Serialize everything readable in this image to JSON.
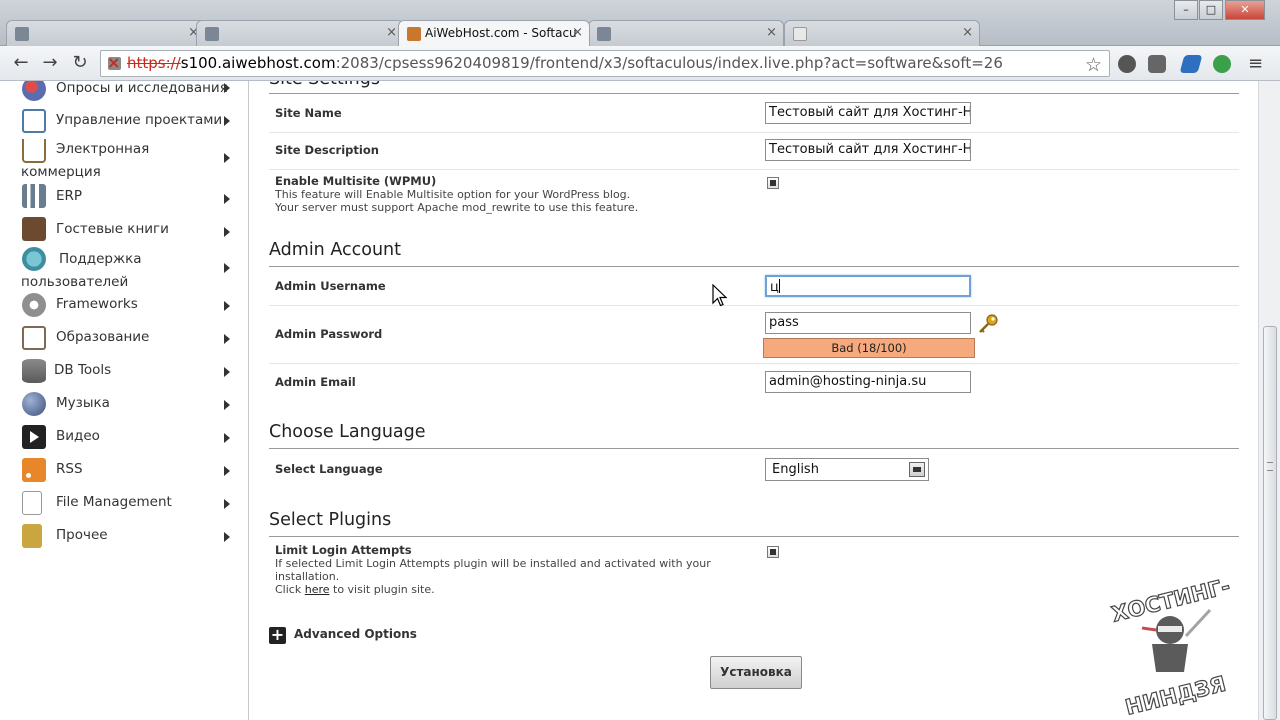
{
  "browser": {
    "tabs": [
      {
        "label": "",
        "active": false
      },
      {
        "label": "",
        "active": false
      },
      {
        "label": "AiWebHost.com - Softacu",
        "active": true
      },
      {
        "label": "",
        "active": false
      },
      {
        "label": "",
        "active": false
      }
    ],
    "url": {
      "protocol": "https://",
      "host": "s100.aiwebhost.com",
      "path": ":2083/cpsess9620409819/frontend/x3/softaculous/index.live.php?act=software&soft=26"
    },
    "win_minimize": "–",
    "win_maximize": "□",
    "win_close": "✕"
  },
  "sidebar": {
    "items": [
      {
        "label": "Опросы и исследования",
        "icon": "polls-icon",
        "color": "#5b6db0"
      },
      {
        "label": "Управление проектами",
        "icon": "project-management-icon",
        "color": "#4f7aa6"
      },
      {
        "label": "Электронная",
        "label_line2": "коммерция",
        "icon": "cart-icon",
        "color": "#8a6d3b"
      },
      {
        "label": "ERP",
        "icon": "erp-icon",
        "color": "#6a7d8f"
      },
      {
        "label": "Гостевые книги",
        "icon": "guestbook-icon",
        "color": "#6b4a2f"
      },
      {
        "label": "Поддержка",
        "label_line2": "пользователей",
        "icon": "support-icon",
        "color": "#3d8e9e"
      },
      {
        "label": "Frameworks",
        "icon": "frameworks-icon",
        "color": "#8f8f8f"
      },
      {
        "label": "Образование",
        "icon": "education-icon",
        "color": "#7c6a55"
      },
      {
        "label": "DB Tools",
        "icon": "db-tools-icon",
        "color": "#6e6e6e"
      },
      {
        "label": "Музыка",
        "icon": "music-icon",
        "color": "#3b4f7a"
      },
      {
        "label": "Видео",
        "icon": "video-icon",
        "color": "#222222"
      },
      {
        "label": "RSS",
        "icon": "rss-icon",
        "color": "#e8862a"
      },
      {
        "label": "File Management",
        "icon": "file-icon",
        "color": "#d8d8d8"
      },
      {
        "label": "Прочее",
        "icon": "misc-icon",
        "color": "#c9a640"
      }
    ]
  },
  "form": {
    "site_settings_title": "Site Settings",
    "site_name_label": "Site Name",
    "site_name_value": "Тестовый сайт для Хостинг-Ниндзя",
    "site_desc_label": "Site Description",
    "site_desc_value": "Тестовый сайт для Хостинг-Ниндзя",
    "multisite_label": "Enable Multisite (WPMU)",
    "multisite_help1": "This feature will Enable Multisite option for your WordPress blog.",
    "multisite_help2": "Your server must support Apache mod_rewrite to use this feature.",
    "admin_account_title": "Admin Account",
    "admin_username_label": "Admin Username",
    "admin_username_value": "ц",
    "admin_password_label": "Admin Password",
    "admin_password_value": "pass",
    "password_strength": "Bad (18/100)",
    "admin_email_label": "Admin Email",
    "admin_email_value": "admin@hosting-ninja.su",
    "choose_language_title": "Choose Language",
    "select_language_label": "Select Language",
    "select_language_value": "English",
    "select_plugins_title": "Select Plugins",
    "limit_login_label": "Limit Login Attempts",
    "limit_login_help1": "If selected Limit Login Attempts plugin will be installed and activated with your",
    "limit_login_help2": "installation.",
    "limit_login_help3_pre": "Click ",
    "limit_login_help3_link": "here",
    "limit_login_help3_post": " to visit plugin site.",
    "advanced_options_label": "Advanced Options",
    "install_button": "Установка"
  },
  "watermark": {
    "line1": "ХОСТИНГ-",
    "line2": "НИНДЗЯ"
  },
  "colors": {
    "strength_bad": "#f6a97c",
    "focus_ring": "#6fa0d6",
    "insecure_protocol": "#c62b1d"
  }
}
